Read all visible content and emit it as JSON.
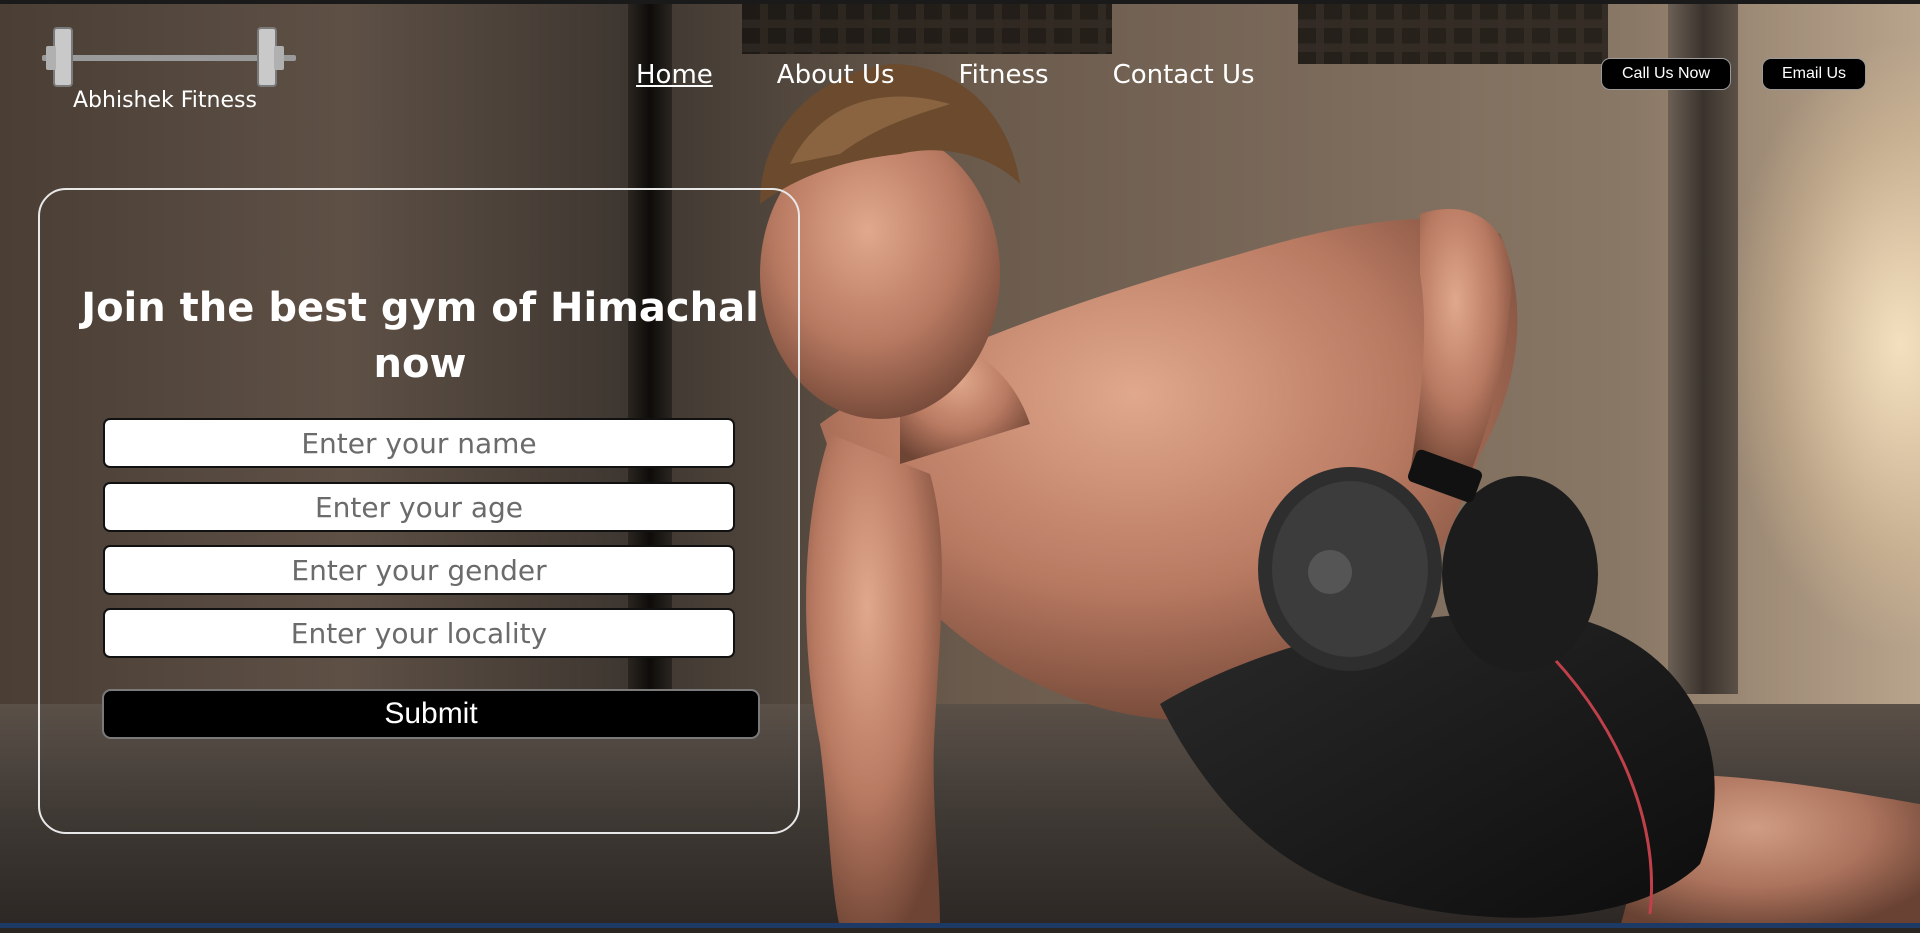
{
  "brand": {
    "name": "Abhishek Fitness",
    "logo_icon": "barbell-icon"
  },
  "nav": {
    "items": [
      {
        "label": "Home",
        "active": true
      },
      {
        "label": "About Us",
        "active": false
      },
      {
        "label": "Fitness",
        "active": false
      },
      {
        "label": "Contact Us",
        "active": false
      }
    ]
  },
  "actions": {
    "call_label": "Call Us Now",
    "email_label": "Email Us"
  },
  "join_form": {
    "title": "Join the best gym of Himachal now",
    "fields": [
      {
        "placeholder": "Enter your name",
        "value": ""
      },
      {
        "placeholder": "Enter your age",
        "value": ""
      },
      {
        "placeholder": "Enter your gender",
        "value": ""
      },
      {
        "placeholder": "Enter your locality",
        "value": ""
      }
    ],
    "submit_label": "Submit"
  },
  "colors": {
    "button_bg": "#000000",
    "text": "#ffffff",
    "card_border": "#e8e8e8",
    "footer_bar": "#1d3a66"
  }
}
